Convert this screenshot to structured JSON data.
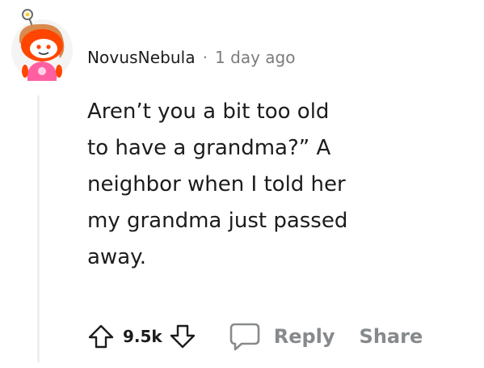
{
  "comment": {
    "username": "NovusNebula",
    "separator": "·",
    "time": "1 day ago",
    "body_lines": [
      "Aren’t you a bit too old",
      "to have a grandma?” A",
      "neighbor when I told her",
      "my grandma just passed",
      "away."
    ],
    "score": "9.5k",
    "reply_label": "Reply",
    "share_label": "Share"
  },
  "icons": {
    "avatar": "snoo-avatar",
    "upvote": "upvote-arrow-icon",
    "downvote": "downvote-arrow-icon",
    "reply": "speech-bubble-icon"
  },
  "colors": {
    "text": "#1c1c1c",
    "muted": "#878a8c",
    "avatar_orange": "#ff4500",
    "avatar_hair": "#d98a4e",
    "avatar_shirt": "#ff5fa2",
    "thread_line": "#edeff1"
  }
}
